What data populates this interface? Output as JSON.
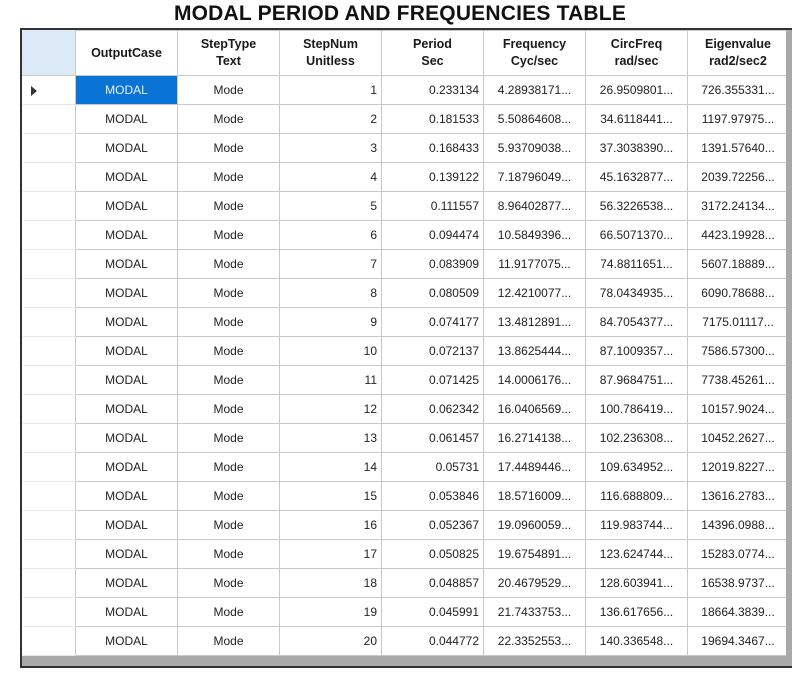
{
  "title": "MODAL PERIOD AND FREQUENCIES TABLE",
  "columns": [
    {
      "line1": "OutputCase",
      "line2": ""
    },
    {
      "line1": "StepType",
      "line2": "Text"
    },
    {
      "line1": "StepNum",
      "line2": "Unitless"
    },
    {
      "line1": "Period",
      "line2": "Sec"
    },
    {
      "line1": "Frequency",
      "line2": "Cyc/sec"
    },
    {
      "line1": "CircFreq",
      "line2": "rad/sec"
    },
    {
      "line1": "Eigenvalue",
      "line2": "rad2/sec2"
    }
  ],
  "selected_row": 0,
  "selection_color": "#0a74d6",
  "rows": [
    {
      "case": "MODAL",
      "type": "Mode",
      "num": "1",
      "period": "0.233134",
      "freq": "4.28938171...",
      "circ": "26.9509801...",
      "eigen": "726.355331..."
    },
    {
      "case": "MODAL",
      "type": "Mode",
      "num": "2",
      "period": "0.181533",
      "freq": "5.50864608...",
      "circ": "34.6118441...",
      "eigen": "1197.97975..."
    },
    {
      "case": "MODAL",
      "type": "Mode",
      "num": "3",
      "period": "0.168433",
      "freq": "5.93709038...",
      "circ": "37.3038390...",
      "eigen": "1391.57640..."
    },
    {
      "case": "MODAL",
      "type": "Mode",
      "num": "4",
      "period": "0.139122",
      "freq": "7.18796049...",
      "circ": "45.1632877...",
      "eigen": "2039.72256..."
    },
    {
      "case": "MODAL",
      "type": "Mode",
      "num": "5",
      "period": "0.111557",
      "freq": "8.96402877...",
      "circ": "56.3226538...",
      "eigen": "3172.24134..."
    },
    {
      "case": "MODAL",
      "type": "Mode",
      "num": "6",
      "period": "0.094474",
      "freq": "10.5849396...",
      "circ": "66.5071370...",
      "eigen": "4423.19928..."
    },
    {
      "case": "MODAL",
      "type": "Mode",
      "num": "7",
      "period": "0.083909",
      "freq": "11.9177075...",
      "circ": "74.8811651...",
      "eigen": "5607.18889..."
    },
    {
      "case": "MODAL",
      "type": "Mode",
      "num": "8",
      "period": "0.080509",
      "freq": "12.4210077...",
      "circ": "78.0434935...",
      "eigen": "6090.78688..."
    },
    {
      "case": "MODAL",
      "type": "Mode",
      "num": "9",
      "period": "0.074177",
      "freq": "13.4812891...",
      "circ": "84.7054377...",
      "eigen": "7175.01117..."
    },
    {
      "case": "MODAL",
      "type": "Mode",
      "num": "10",
      "period": "0.072137",
      "freq": "13.8625444...",
      "circ": "87.1009357...",
      "eigen": "7586.57300..."
    },
    {
      "case": "MODAL",
      "type": "Mode",
      "num": "11",
      "period": "0.071425",
      "freq": "14.0006176...",
      "circ": "87.9684751...",
      "eigen": "7738.45261..."
    },
    {
      "case": "MODAL",
      "type": "Mode",
      "num": "12",
      "period": "0.062342",
      "freq": "16.0406569...",
      "circ": "100.786419...",
      "eigen": "10157.9024..."
    },
    {
      "case": "MODAL",
      "type": "Mode",
      "num": "13",
      "period": "0.061457",
      "freq": "16.2714138...",
      "circ": "102.236308...",
      "eigen": "10452.2627..."
    },
    {
      "case": "MODAL",
      "type": "Mode",
      "num": "14",
      "period": "0.05731",
      "freq": "17.4489446...",
      "circ": "109.634952...",
      "eigen": "12019.8227..."
    },
    {
      "case": "MODAL",
      "type": "Mode",
      "num": "15",
      "period": "0.053846",
      "freq": "18.5716009...",
      "circ": "116.688809...",
      "eigen": "13616.2783..."
    },
    {
      "case": "MODAL",
      "type": "Mode",
      "num": "16",
      "period": "0.052367",
      "freq": "19.0960059...",
      "circ": "119.983744...",
      "eigen": "14396.0988..."
    },
    {
      "case": "MODAL",
      "type": "Mode",
      "num": "17",
      "period": "0.050825",
      "freq": "19.6754891...",
      "circ": "123.624744...",
      "eigen": "15283.0774..."
    },
    {
      "case": "MODAL",
      "type": "Mode",
      "num": "18",
      "period": "0.048857",
      "freq": "20.4679529...",
      "circ": "128.603941...",
      "eigen": "16538.9737..."
    },
    {
      "case": "MODAL",
      "type": "Mode",
      "num": "19",
      "period": "0.045991",
      "freq": "21.7433753...",
      "circ": "136.617656...",
      "eigen": "18664.3839..."
    },
    {
      "case": "MODAL",
      "type": "Mode",
      "num": "20",
      "period": "0.044772",
      "freq": "22.3352553...",
      "circ": "140.336548...",
      "eigen": "19694.3467..."
    }
  ]
}
